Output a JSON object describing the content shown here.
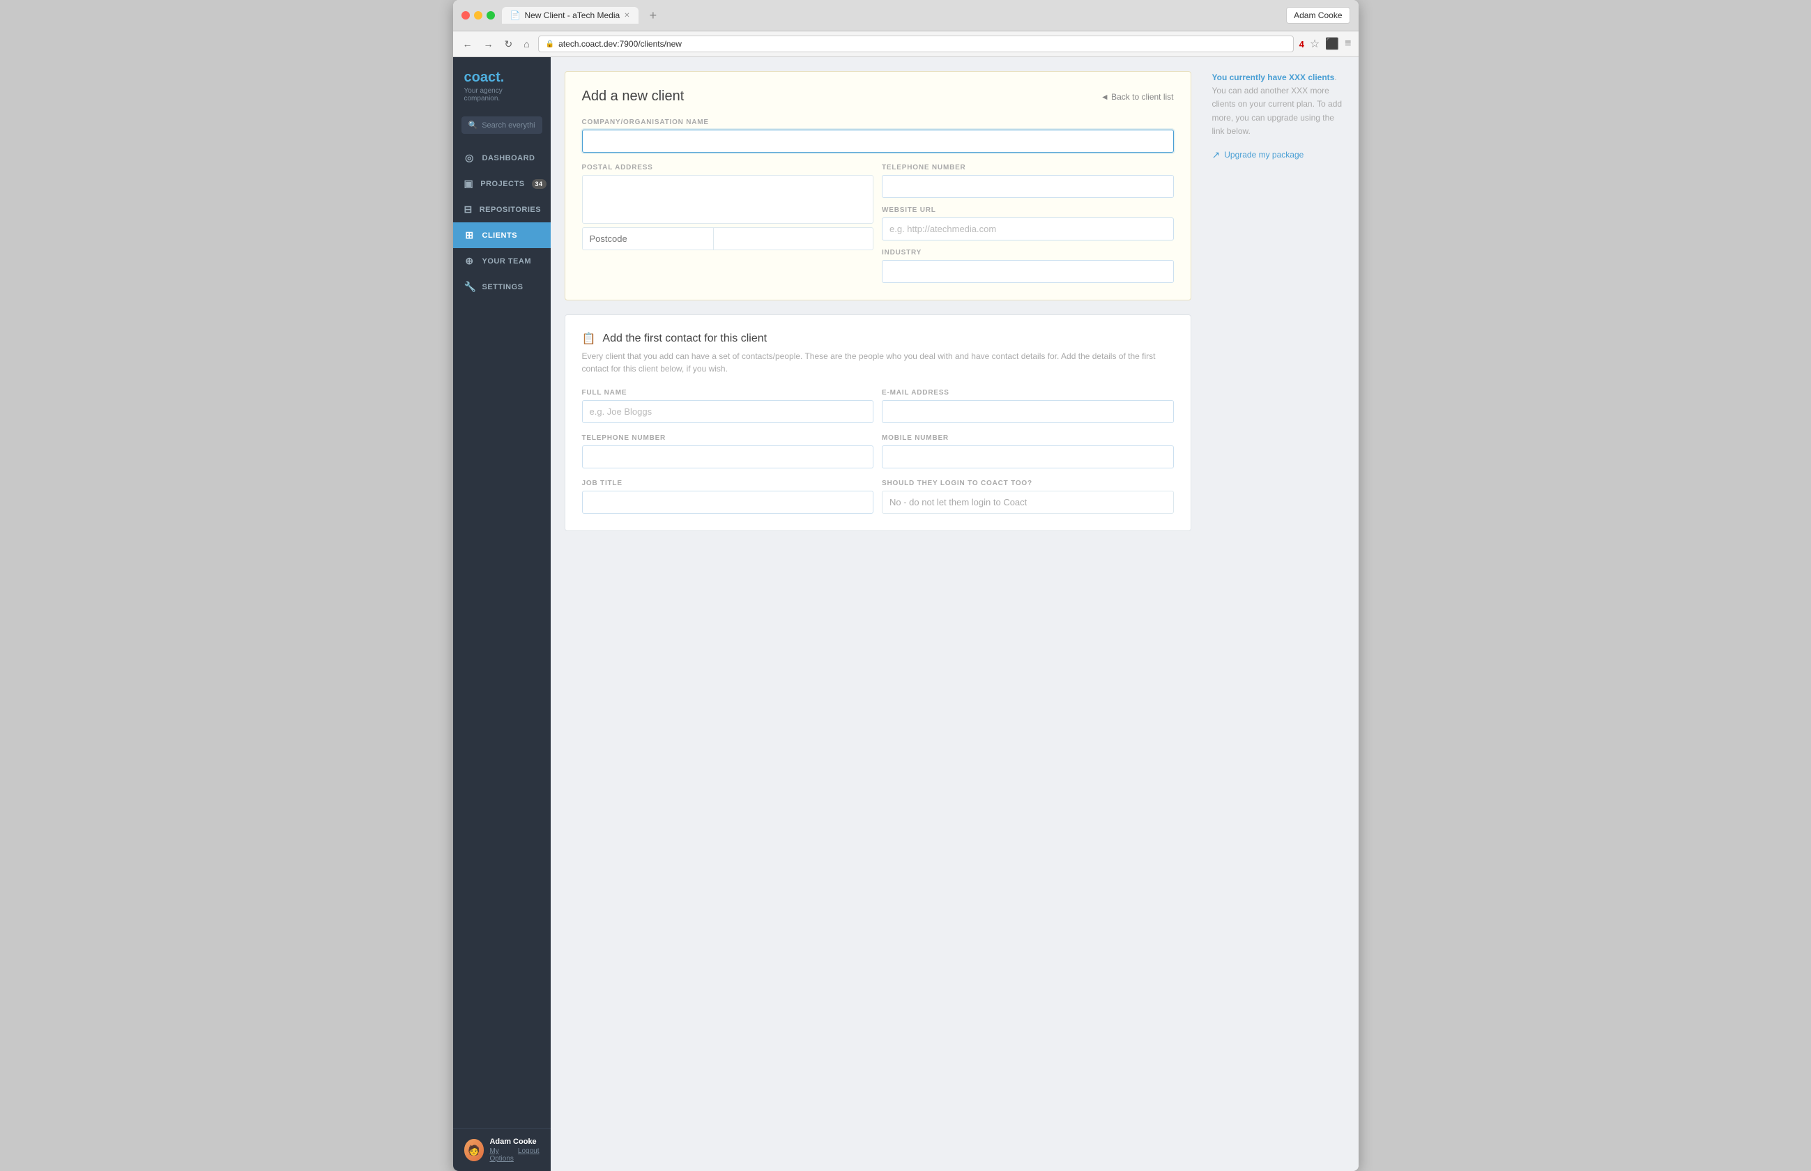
{
  "browser": {
    "tab_title": "New Client - aTech Media",
    "url": "atech.coact.dev:7900/clients/new",
    "user": "Adam Cooke",
    "badge_count": "4"
  },
  "sidebar": {
    "logo": "coact.",
    "logo_sub": "Your agency companion.",
    "search_placeholder": "Search everything...",
    "nav_items": [
      {
        "id": "dashboard",
        "label": "DASHBOARD",
        "icon": "◎",
        "badge": ""
      },
      {
        "id": "projects",
        "label": "PROJECTS",
        "icon": "▣",
        "badge": "34"
      },
      {
        "id": "repositories",
        "label": "REPOSITORIES",
        "icon": "⊟",
        "badge": ""
      },
      {
        "id": "clients",
        "label": "CLIENTS",
        "icon": "⊞",
        "badge": "",
        "active": true
      },
      {
        "id": "your-team",
        "label": "YOUR TEAM",
        "icon": "⊕",
        "badge": ""
      },
      {
        "id": "settings",
        "label": "SETTINGS",
        "icon": "⚙",
        "badge": ""
      }
    ],
    "user_name": "Adam Cooke",
    "my_options": "My Options",
    "logout": "Logout"
  },
  "main": {
    "card_title": "Add a new client",
    "back_link": "◄ Back to client list",
    "fields": {
      "company_label": "COMPANY/ORGANISATION NAME",
      "company_placeholder": "",
      "postal_label": "POSTAL ADDRESS",
      "postcode_placeholder": "Postcode",
      "telephone_label": "TELEPHONE NUMBER",
      "website_label": "WEBSITE URL",
      "website_placeholder": "e.g. http://atechmedia.com",
      "industry_label": "INDUSTRY"
    },
    "contact_section": {
      "title": "Add the first contact for this client",
      "description": "Every client that you add can have a set of contacts/people. These are the people who you deal with and have contact details for. Add the details of the first contact for this client below, if you wish.",
      "full_name_label": "FULL NAME",
      "full_name_placeholder": "e.g. Joe Bloggs",
      "email_label": "E-MAIL ADDRESS",
      "telephone_label": "TELEPHONE NUMBER",
      "mobile_label": "MOBILE NUMBER",
      "job_title_label": "JOB TITLE",
      "login_label": "SHOULD THEY LOGIN TO COACT TOO?",
      "login_default": "No - do not let them login to Coact"
    }
  },
  "sidebar_info": {
    "text_before_strong": "You currently have ",
    "strong_text": "XXX clients",
    "text_after": ". You can add another XXX more clients on your current plan. To add more, you can upgrade using the link below.",
    "upgrade_label": "Upgrade my package"
  }
}
